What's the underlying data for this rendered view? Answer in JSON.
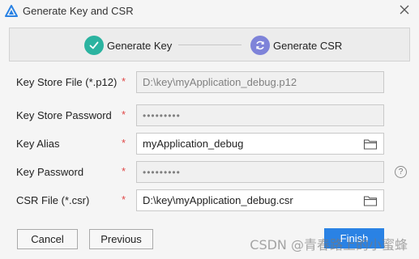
{
  "window": {
    "title": "Generate Key and CSR",
    "app_icon": "deveco-triangle-icon",
    "close_icon": "close-icon"
  },
  "steps": [
    {
      "label": "Generate Key",
      "state": "completed",
      "icon": "check-icon",
      "color": "#2bb3a0"
    },
    {
      "label": "Generate CSR",
      "state": "current",
      "icon": "refresh-icon",
      "color": "#7e83d9"
    }
  ],
  "form": {
    "key_store_file": {
      "label": "Key Store File (*.p12)",
      "required": "*",
      "value": "D:\\key\\myApplication_debug.p12",
      "disabled": true
    },
    "key_store_password": {
      "label": "Key Store Password",
      "required": "*",
      "value": "•••••••••",
      "disabled": true
    },
    "key_alias": {
      "label": "Key Alias",
      "required": "*",
      "value": "myApplication_debug",
      "folder_icon": "folder-icon"
    },
    "key_password": {
      "label": "Key Password",
      "required": "*",
      "value": "•••••••••",
      "disabled": true,
      "help": "?"
    },
    "csr_file": {
      "label": "CSR File (*.csr)",
      "required": "*",
      "value": "D:\\key\\myApplication_debug.csr",
      "folder_icon": "folder-icon"
    }
  },
  "buttons": {
    "cancel": "Cancel",
    "previous": "Previous",
    "finish": "Finish"
  },
  "watermark": "CSDN @青春路上的小蜜蜂",
  "colors": {
    "accent": "#2a82e4",
    "required": "#e04848"
  }
}
